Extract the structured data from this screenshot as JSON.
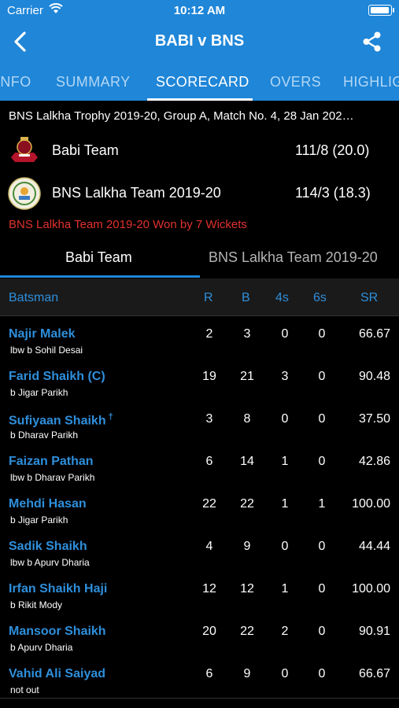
{
  "status_bar": {
    "carrier": "Carrier",
    "time": "10:12 AM"
  },
  "nav": {
    "title": "BABI v BNS"
  },
  "tabs": [
    {
      "label": "INFO",
      "active": false
    },
    {
      "label": "SUMMARY",
      "active": false
    },
    {
      "label": "SCORECARD",
      "active": true
    },
    {
      "label": "OVERS",
      "active": false
    },
    {
      "label": "HIGHLIG",
      "active": false
    }
  ],
  "match": {
    "info": "BNS Lalkha Trophy 2019-20, Group A, Match No. 4, 28 Jan 202…",
    "teams": [
      {
        "name": "Babi Team",
        "score": "111/8 (20.0)"
      },
      {
        "name": "BNS Lalkha Team 2019-20",
        "score": "114/3 (18.3)"
      }
    ],
    "result": "BNS Lalkha Team 2019-20 Won by 7 Wickets"
  },
  "innings_tabs": [
    "Babi Team",
    "BNS Lalkha Team 2019-20"
  ],
  "batting_header": {
    "batsman": "Batsman",
    "r": "R",
    "b": "B",
    "fours": "4s",
    "sixes": "6s",
    "sr": "SR"
  },
  "batsmen": [
    {
      "name": "Najir Malek",
      "dismissal": "lbw  b Sohil Desai",
      "r": "2",
      "b": "3",
      "fours": "0",
      "sixes": "0",
      "sr": "66.67"
    },
    {
      "name": "Farid Shaikh (C)",
      "dismissal": "b Jigar Parikh",
      "r": "19",
      "b": "21",
      "fours": "3",
      "sixes": "0",
      "sr": "90.48"
    },
    {
      "name": "Sufiyaan Shaikh",
      "marker": "†",
      "dismissal": "b Dharav Parikh",
      "r": "3",
      "b": "8",
      "fours": "0",
      "sixes": "0",
      "sr": "37.50"
    },
    {
      "name": "Faizan Pathan",
      "dismissal": "lbw  b Dharav Parikh",
      "r": "6",
      "b": "14",
      "fours": "1",
      "sixes": "0",
      "sr": "42.86"
    },
    {
      "name": "Mehdi Hasan",
      "dismissal": "b Jigar Parikh",
      "r": "22",
      "b": "22",
      "fours": "1",
      "sixes": "1",
      "sr": "100.00"
    },
    {
      "name": "Sadik Shaikh",
      "dismissal": "lbw  b Apurv Dharia",
      "r": "4",
      "b": "9",
      "fours": "0",
      "sixes": "0",
      "sr": "44.44"
    },
    {
      "name": "Irfan Shaikh Haji",
      "dismissal": "b Rikit Mody",
      "r": "12",
      "b": "12",
      "fours": "1",
      "sixes": "0",
      "sr": "100.00"
    },
    {
      "name": "Mansoor Shaikh",
      "dismissal": "b Apurv Dharia",
      "r": "20",
      "b": "22",
      "fours": "2",
      "sixes": "0",
      "sr": "90.91"
    },
    {
      "name": "Vahid Ali Saiyad",
      "dismissal": "not out",
      "r": "6",
      "b": "9",
      "fours": "0",
      "sixes": "0",
      "sr": "66.67"
    }
  ],
  "colors": {
    "header_blue": "#1f86d8",
    "link_blue": "#2e8fdc",
    "result_red": "#e0322d"
  }
}
